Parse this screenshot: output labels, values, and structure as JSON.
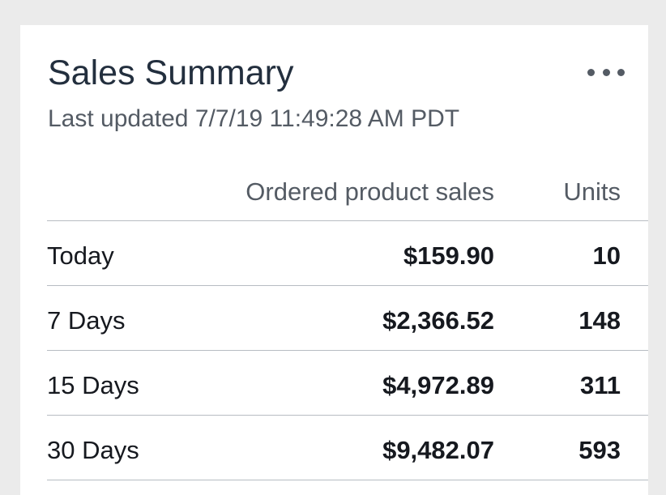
{
  "widget": {
    "title": "Sales Summary",
    "last_updated": "Last updated 7/7/19 11:49:28 AM PDT",
    "menu_icon": "more-horizontal-icon"
  },
  "table": {
    "columns": {
      "period": "",
      "sales": "Ordered product sales",
      "units": "Units"
    },
    "rows": [
      {
        "period": "Today",
        "sales": "$159.90",
        "units": "10"
      },
      {
        "period": "7 Days",
        "sales": "$2,366.52",
        "units": "148"
      },
      {
        "period": "15 Days",
        "sales": "$4,972.89",
        "units": "311"
      },
      {
        "period": "30 Days",
        "sales": "$9,482.07",
        "units": "593"
      }
    ]
  },
  "colors": {
    "page_background": "#ebebeb",
    "card_background": "#ffffff",
    "title_text": "#232f3e",
    "secondary_text": "#545b64",
    "divider": "#b7bcc2"
  }
}
